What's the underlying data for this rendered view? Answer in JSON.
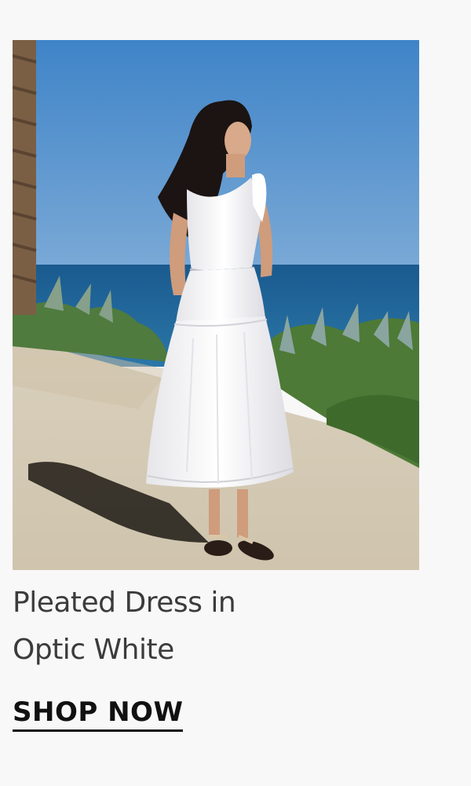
{
  "product": {
    "title_line1": "Pleated Dress in",
    "title_line2": "Optic White",
    "image_alt": "Woman wearing a white tiered pleated midi dress standing on a seaside terrace"
  },
  "cta": {
    "label": "SHOP NOW"
  },
  "colors": {
    "background": "#f8f8f8",
    "text": "#3b3b3b",
    "cta": "#111111",
    "sky": "#4f8ec8",
    "sea": "#1d5f93"
  }
}
